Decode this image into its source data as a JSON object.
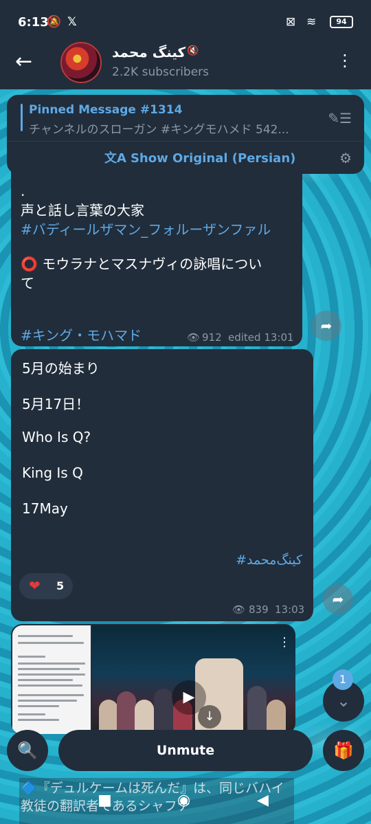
{
  "status_bar": {
    "time": "6:13",
    "battery": "94"
  },
  "header": {
    "back_icon": "arrow-left-icon",
    "channel_name": "کینگ محمد",
    "subscribers": "2.2K subscribers",
    "menu_icon": "more-vertical-icon"
  },
  "pinned": {
    "title": "Pinned Message #1314",
    "preview": "チャンネルのスローガン #キングモハメド 542...",
    "translate_label": "Show Original (Persian)"
  },
  "messages": [
    {
      "lines": [
        ".",
        "声と話し言葉の大家",
        "#バディールザマン_フォルーザンファル",
        "⭕ モウラナとマスナヴィの詠唱につい",
        "て",
        "#キング・モハマド"
      ],
      "views": "912",
      "time": "edited 13:01"
    },
    {
      "lines": [
        "5月の始まり",
        "5月17日！",
        "Who Is Q?",
        "King Is Q",
        "17May"
      ],
      "hashtag": "#کینگ‌محمد",
      "reaction_count": "5",
      "views": "839",
      "time": "13:03"
    }
  ],
  "scroll_badge": "1",
  "bottom": {
    "unmute_label": "Unmute"
  },
  "next_message_preview": "🔷『デュルケームは死んだ』は、同じバハイ教徒の翻訳者であるシャフナ"
}
